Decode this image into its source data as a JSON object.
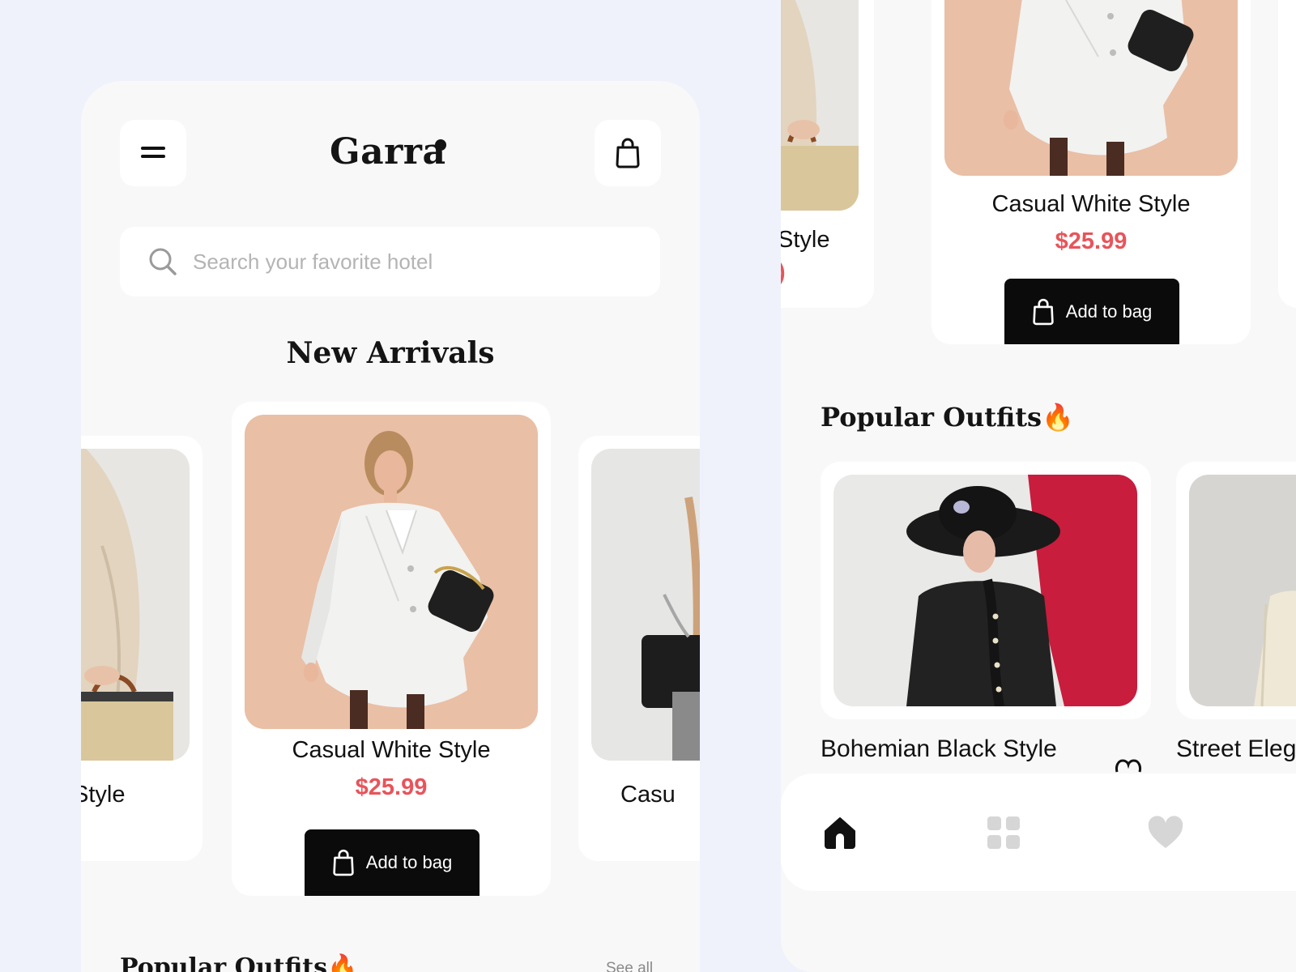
{
  "app": {
    "name": "Garra"
  },
  "search": {
    "placeholder": "Search your favorite hotel"
  },
  "sections": {
    "new_arrivals": "New Arrivals",
    "popular_outfits": "Popular Outfits",
    "popular_emoji": "🔥",
    "see_all": "See all"
  },
  "new_arrivals": [
    {
      "title": "Casual White Style",
      "price": "$25.99",
      "button": "Add to bag"
    }
  ],
  "partial_cards": {
    "left_title": "Style",
    "right_title": "Casu",
    "left_price_fragment": ")"
  },
  "popular": [
    {
      "title": "Bohemian Black Style"
    },
    {
      "title": "Street Eleg"
    }
  ],
  "colors": {
    "background": "#eff2fb",
    "surface": "#f8f8f8",
    "card": "#ffffff",
    "text": "#111111",
    "price": "#e8545a",
    "button": "#0b0b0b",
    "placeholder": "#b4b4b4",
    "nav_inactive": "#d6d6d6"
  },
  "icons": {
    "menu": "menu-icon",
    "bag": "shopping-bag-icon",
    "search": "search-icon",
    "home": "home-icon",
    "grid": "grid-icon",
    "heart": "heart-icon",
    "fire": "fire-icon"
  }
}
